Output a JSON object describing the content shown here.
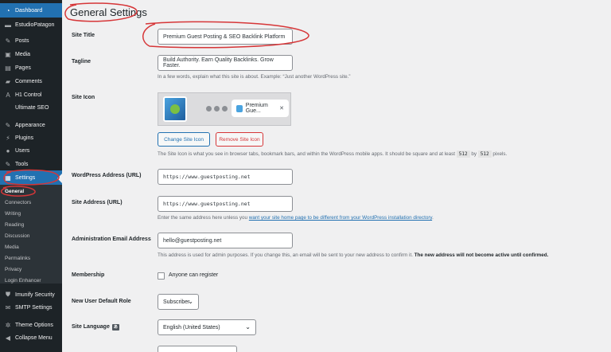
{
  "sidebar": {
    "items": [
      {
        "label": "Dashboard",
        "icon": "dashboard-icon",
        "glyph": "◔"
      },
      {
        "label": "EstudioPatagon",
        "icon": "logo-icon",
        "glyph": "▬"
      },
      {
        "label": "Posts",
        "icon": "pin-icon",
        "glyph": "✎"
      },
      {
        "label": "Media",
        "icon": "media-icon",
        "glyph": "▣"
      },
      {
        "label": "Pages",
        "icon": "pages-icon",
        "glyph": "▤"
      },
      {
        "label": "Comments",
        "icon": "comment-icon",
        "glyph": "▰"
      },
      {
        "label": "H1 Control",
        "icon": "h1-icon",
        "glyph": "A"
      },
      {
        "label": "Ultimate SEO",
        "icon": "",
        "glyph": ""
      },
      {
        "label": "Appearance",
        "icon": "brush-icon",
        "glyph": "✎"
      },
      {
        "label": "Plugins",
        "icon": "plugin-icon",
        "glyph": "⚡"
      },
      {
        "label": "Users",
        "icon": "user-icon",
        "glyph": "●"
      },
      {
        "label": "Tools",
        "icon": "wrench-icon",
        "glyph": "✎"
      },
      {
        "label": "Settings",
        "icon": "settings-icon",
        "glyph": "▦"
      }
    ],
    "submenu": [
      "General",
      "Connectors",
      "Writing",
      "Reading",
      "Discussion",
      "Media",
      "Permalinks",
      "Privacy",
      "Login Enhancer"
    ],
    "bottom": [
      {
        "label": "Imunify Security",
        "icon": "shield-icon",
        "glyph": "⛊"
      },
      {
        "label": "SMTP Settings",
        "icon": "mail-icon",
        "glyph": "✉"
      },
      {
        "label": "Theme Options",
        "icon": "gear-icon",
        "glyph": "✲"
      },
      {
        "label": "Collapse Menu",
        "icon": "collapse-icon",
        "glyph": "◀"
      }
    ]
  },
  "page": {
    "title": "General Settings",
    "site_title_label": "Site Title",
    "site_title_value": "Premium Guest Posting & SEO Backlink Platform",
    "tagline_label": "Tagline",
    "tagline_value": "Build Authority. Earn Quality Backlinks. Grow Faster.",
    "tagline_desc": "In a few words, explain what this site is about. Example: “Just another WordPress site.”",
    "site_icon_label": "Site Icon",
    "icon_tab_text": "Premium Gue...",
    "change_icon_label": "Change Site Icon",
    "remove_icon_label": "Remove Site Icon",
    "site_icon_desc_pre": "The Site Icon is what you see in browser tabs, bookmark bars, and within the WordPress mobile apps. It should be square and at least",
    "site_icon_code1": "512",
    "site_icon_by": "by",
    "site_icon_code2": "512",
    "site_icon_desc_post": "pixels.",
    "wp_address_label": "WordPress Address (URL)",
    "wp_address_value": "https://www.guestposting.net",
    "site_address_label": "Site Address (URL)",
    "site_address_value": "https://www.guestposting.net",
    "site_address_desc_pre": "Enter the same address here unless you",
    "site_address_link": "want your site home page to be different from your WordPress installation directory",
    "site_address_desc_post": ".",
    "admin_email_label": "Administration Email Address",
    "admin_email_value": "hello@guestposting.net",
    "admin_email_desc": "This address is used for admin purposes. If you change this, an email will be sent to your new address to confirm it.",
    "admin_email_desc_bold": "The new address will not become active until confirmed.",
    "membership_label": "Membership",
    "membership_checkbox": "Anyone can register",
    "default_role_label": "New User Default Role",
    "default_role_value": "Subscriber",
    "language_label": "Site Language",
    "language_value": "English (United States)"
  },
  "colors": {
    "accent": "#2271b1",
    "annotation": "#d63638",
    "sidebar": "#1d2327"
  }
}
